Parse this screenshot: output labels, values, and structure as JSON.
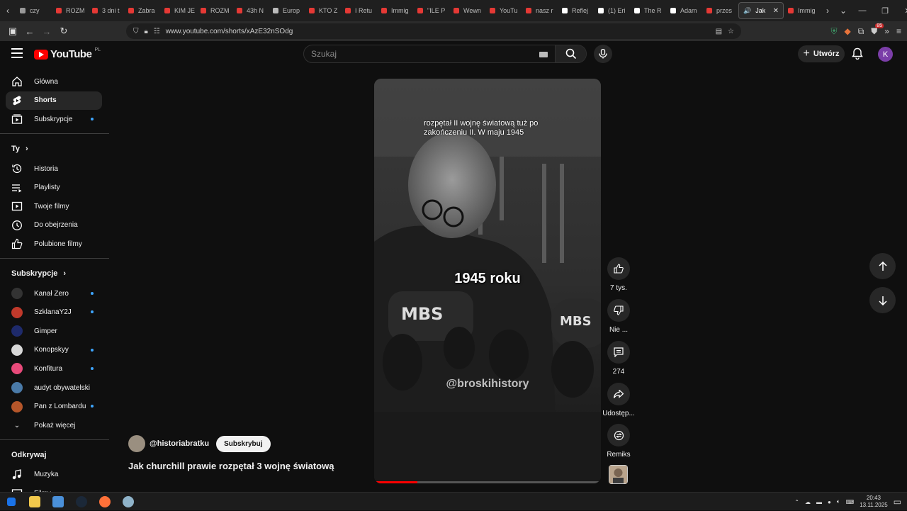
{
  "browser": {
    "tabs": [
      {
        "label": "czy",
        "color": "#999"
      },
      {
        "label": "ROZM",
        "color": "#e53935"
      },
      {
        "label": "3 dni t",
        "color": "#e53935"
      },
      {
        "label": "Zabra",
        "color": "#e53935"
      },
      {
        "label": "KIM JE",
        "color": "#e53935"
      },
      {
        "label": "ROZM",
        "color": "#e53935"
      },
      {
        "label": "43h N",
        "color": "#e53935"
      },
      {
        "label": "Europ",
        "color": "#bbbbbb"
      },
      {
        "label": "KTO Z",
        "color": "#e53935"
      },
      {
        "label": "I Retu",
        "color": "#e53935"
      },
      {
        "label": "Immig",
        "color": "#e53935"
      },
      {
        "label": "\"ILE P",
        "color": "#e53935"
      },
      {
        "label": "Wewn",
        "color": "#e53935"
      },
      {
        "label": "YouTu",
        "color": "#e53935"
      },
      {
        "label": "nasz r",
        "color": "#e53935"
      },
      {
        "label": "Reflej",
        "color": "#ffffff"
      },
      {
        "label": "(1) Eri",
        "color": "#ffffff"
      },
      {
        "label": "The R",
        "color": "#ffffff"
      },
      {
        "label": "Adam",
        "color": "#ffffff"
      },
      {
        "label": "przes",
        "color": "#e53935"
      }
    ],
    "active_tab": "Jak",
    "last_tab": "Immig",
    "url": "www.youtube.com/shorts/xAzE32nSOdg",
    "ext_badge": "85"
  },
  "header": {
    "logo_text": "YouTube",
    "logo_region": "PL",
    "search_placeholder": "Szukaj",
    "create_label": "Utwórz",
    "avatar_letter": "K"
  },
  "sidebar": {
    "main": [
      {
        "label": "Główna",
        "icon": "home-icon"
      },
      {
        "label": "Shorts",
        "icon": "shorts-icon",
        "active": true
      },
      {
        "label": "Subskrypcje",
        "icon": "subscriptions-icon",
        "dot": true
      }
    ],
    "you_heading": "Ty",
    "you": [
      {
        "label": "Historia",
        "icon": "history-icon"
      },
      {
        "label": "Playlisty",
        "icon": "playlist-icon"
      },
      {
        "label": "Twoje filmy",
        "icon": "your-videos-icon"
      },
      {
        "label": "Do obejrzenia",
        "icon": "watch-later-icon"
      },
      {
        "label": "Polubione filmy",
        "icon": "liked-icon"
      }
    ],
    "subs_heading": "Subskrypcje",
    "subs": [
      {
        "label": "Kanał Zero",
        "color": "#333333",
        "dot": true
      },
      {
        "label": "SzklanaY2J",
        "color": "#c0392b",
        "dot": true
      },
      {
        "label": "Gimper",
        "color": "#1e2a6b",
        "dot": false
      },
      {
        "label": "Konopskyy",
        "color": "#d8d8d8",
        "dot": true
      },
      {
        "label": "Konfitura",
        "color": "#e84a7a",
        "dot": true
      },
      {
        "label": "audyt obywatelski",
        "color": "#4a7aa8",
        "dot": false
      },
      {
        "label": "Pan z Lombardu",
        "color": "#b5562a",
        "dot": true
      }
    ],
    "show_more": "Pokaż więcej",
    "explore_heading": "Odkrywaj",
    "explore": [
      {
        "label": "Muzyka",
        "icon": "music-icon"
      },
      {
        "label": "Filmy",
        "icon": "movies-icon"
      }
    ]
  },
  "video": {
    "caption_top": "rozpętał II wojnę światową tuż po zakończeniu II. W maju 1945",
    "caption_big": "1945 roku",
    "watermark": "@broskihistory",
    "progress": 0.19
  },
  "actions": {
    "likes": "7 tys.",
    "dislike": "Nie ...",
    "comments": "274",
    "share": "Udostęp...",
    "remix": "Remiks"
  },
  "channel": {
    "name": "@historiabratku",
    "subscribe": "Subskrybuj",
    "title": "Jak churchill prawie rozpętał 3 wojnę światową"
  },
  "taskbar": {
    "time": "20:43",
    "date": "13.11.2025"
  }
}
